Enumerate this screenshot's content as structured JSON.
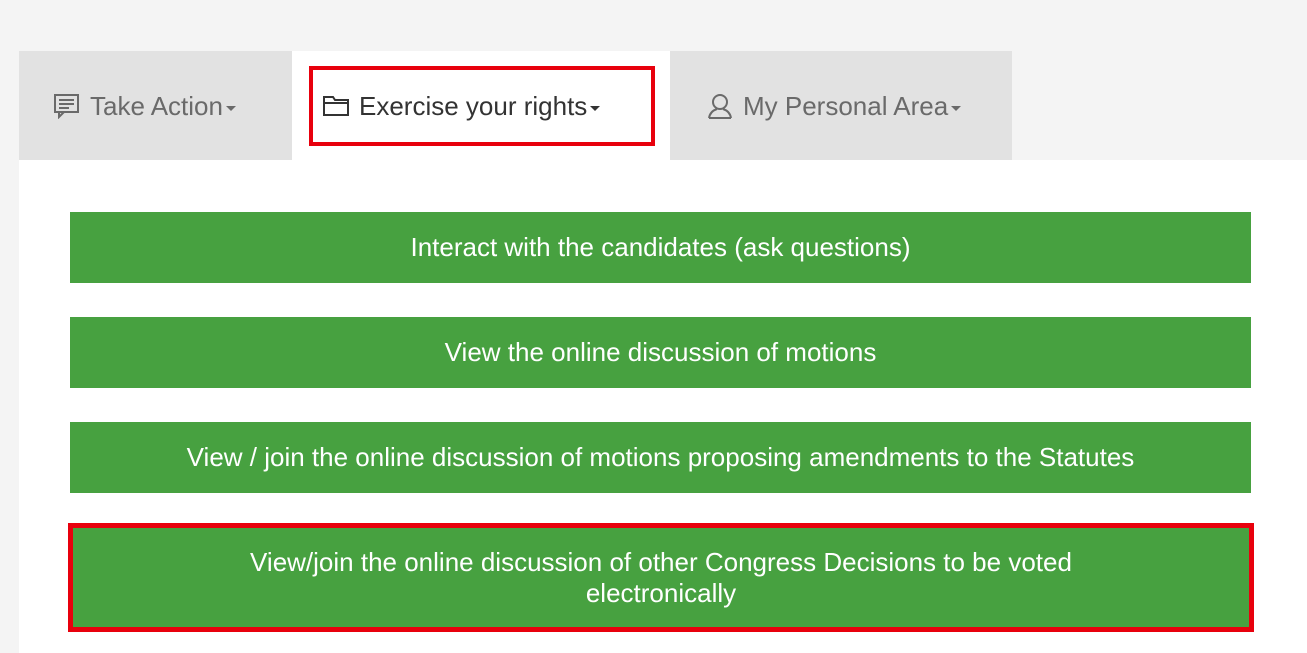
{
  "tabs": [
    {
      "label": "Take Action",
      "icon": "message-icon",
      "active": false
    },
    {
      "label": "Exercise your rights",
      "icon": "folder-icon",
      "active": true
    },
    {
      "label": "My Personal Area",
      "icon": "user-icon",
      "active": false
    }
  ],
  "actions": [
    {
      "label": "Interact with the candidates (ask questions)"
    },
    {
      "label": "View the online discussion of motions"
    },
    {
      "label": "View / join the online discussion of motions proposing amendments to the Statutes"
    },
    {
      "label": "View/join the online discussion of other Congress Decisions to be voted electronically"
    }
  ],
  "colors": {
    "button_green": "#47a140",
    "highlight_red": "#e8000d",
    "inactive_tab": "#e2e2e2"
  }
}
